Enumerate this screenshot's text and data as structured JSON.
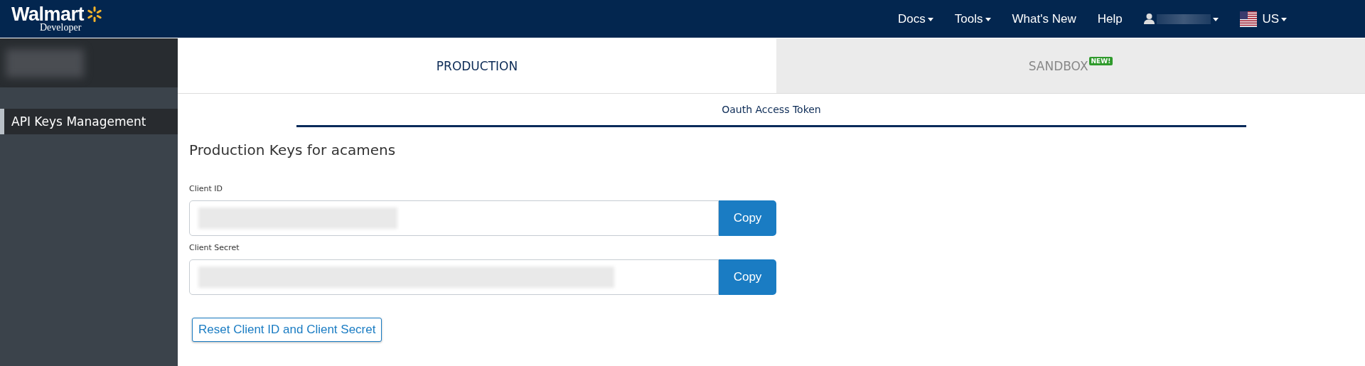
{
  "navbar": {
    "logo": {
      "wordmark": "Walmart",
      "subtitle": "Developer"
    },
    "menu": [
      {
        "kind": "dropdown",
        "label": "Docs"
      },
      {
        "kind": "dropdown",
        "label": "Tools"
      },
      {
        "kind": "link",
        "label": "What's New"
      },
      {
        "kind": "link",
        "label": "Help"
      },
      {
        "kind": "user"
      },
      {
        "kind": "locale",
        "label": "US"
      }
    ]
  },
  "sidebar": {
    "items": [
      {
        "label": "API Keys Management",
        "selected": true
      }
    ]
  },
  "tabs": [
    {
      "label": "PRODUCTION",
      "selected": true
    },
    {
      "label": "SANDBOX",
      "badge": "NEW!",
      "selected": false
    }
  ],
  "subtabs": [
    {
      "label": "Oauth Access Token",
      "selected": true
    }
  ],
  "heading": "Production Keys for acamens",
  "fields": [
    {
      "label": "Client ID",
      "button": "Copy"
    },
    {
      "label": "Client Secret",
      "button": "Copy"
    }
  ],
  "reset_button": "Reset Client ID and Client Secret"
}
